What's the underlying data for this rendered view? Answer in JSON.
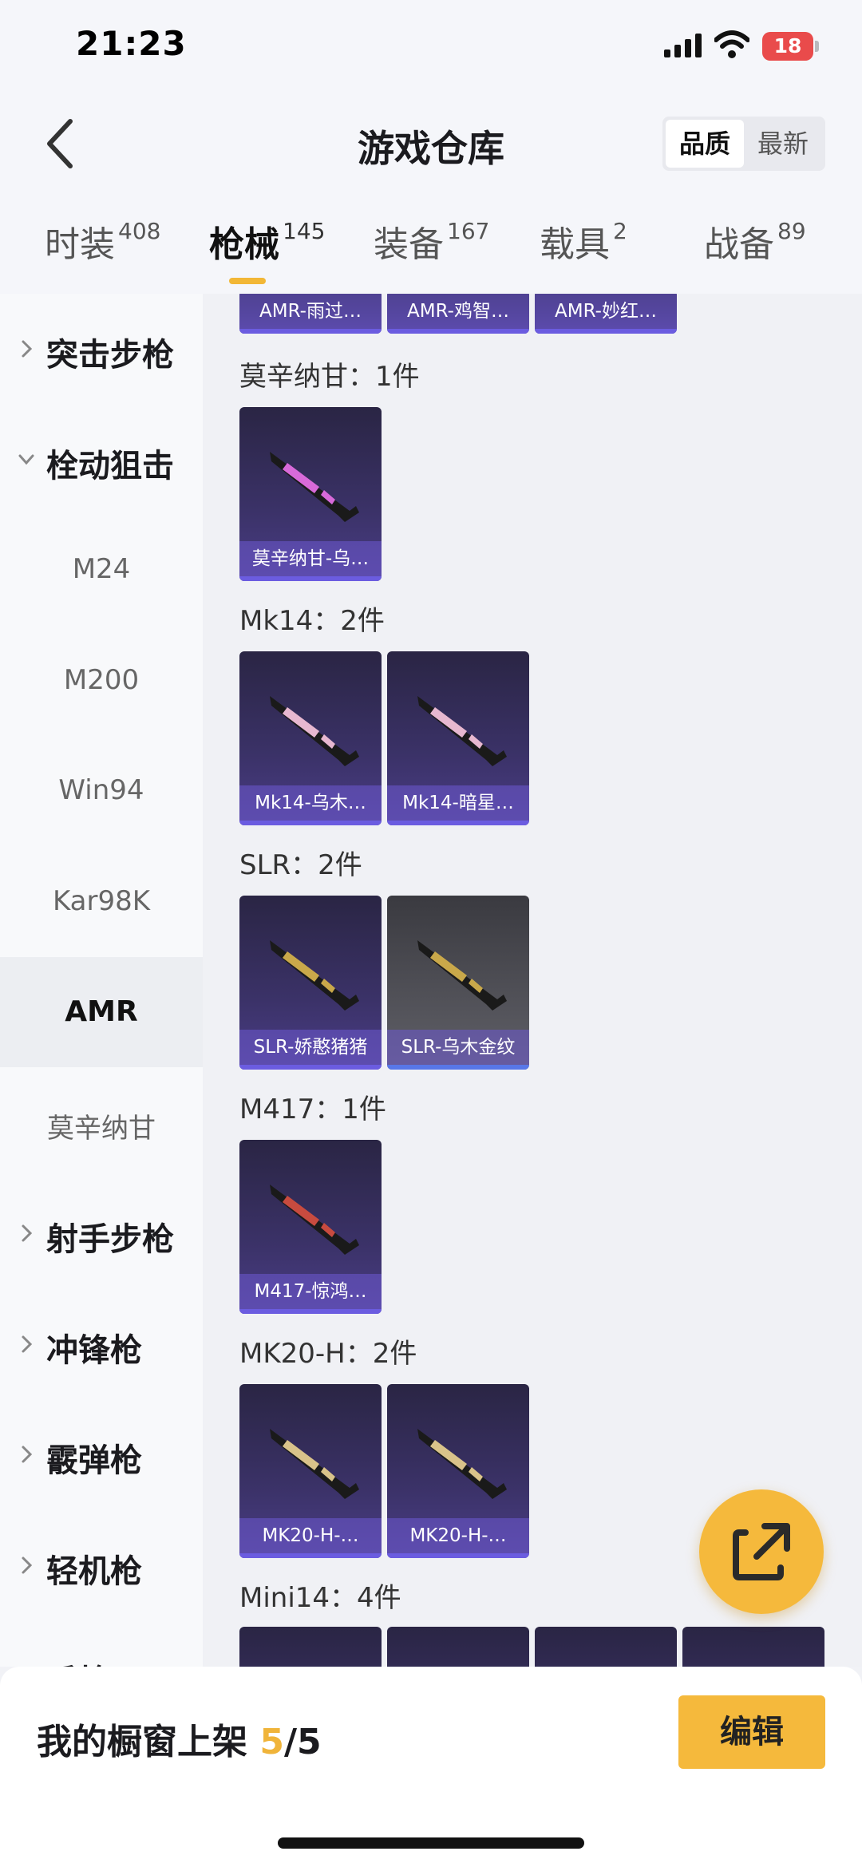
{
  "status_bar": {
    "time": "21:23",
    "battery": "18"
  },
  "header": {
    "title": "游戏仓库",
    "sort_options": [
      "品质",
      "最新"
    ]
  },
  "tabs": [
    {
      "label": "时装",
      "count": "408"
    },
    {
      "label": "枪械",
      "count": "145"
    },
    {
      "label": "装备",
      "count": "167"
    },
    {
      "label": "载具",
      "count": "2"
    },
    {
      "label": "战备",
      "count": "89"
    }
  ],
  "sidebar": [
    {
      "label": "突击步枪",
      "kind": "category"
    },
    {
      "label": "栓动狙击",
      "kind": "category-open"
    },
    {
      "label": "M24",
      "kind": "sub"
    },
    {
      "label": "M200",
      "kind": "sub"
    },
    {
      "label": "Win94",
      "kind": "sub"
    },
    {
      "label": "Kar98K",
      "kind": "sub"
    },
    {
      "label": "AMR",
      "kind": "sub-selected"
    },
    {
      "label": "莫辛纳甘",
      "kind": "sub"
    },
    {
      "label": "射手步枪",
      "kind": "category"
    },
    {
      "label": "冲锋枪",
      "kind": "category"
    },
    {
      "label": "霰弹枪",
      "kind": "category"
    },
    {
      "label": "轻机枪",
      "kind": "category"
    },
    {
      "label": "手枪",
      "kind": "category"
    }
  ],
  "groups": [
    {
      "title": "",
      "items": [
        "AMR-雨过…",
        "AMR-鸡智…",
        "AMR-妙红…"
      ]
    },
    {
      "title": "莫辛纳甘：1件",
      "items": [
        "莫辛纳甘-乌…"
      ]
    },
    {
      "title": "Mk14：2件",
      "items": [
        "Mk14-乌木…",
        "Mk14-暗星…"
      ]
    },
    {
      "title": "SLR：2件",
      "items": [
        "SLR-娇憨猪猪",
        "SLR-乌木金纹"
      ]
    },
    {
      "title": "M417：1件",
      "items": [
        "M417-惊鸿…"
      ]
    },
    {
      "title": "MK20-H：2件",
      "items": [
        "MK20-H-…",
        "MK20-H-…"
      ]
    },
    {
      "title": "Mini14：4件",
      "items": [
        "",
        "",
        "",
        ""
      ]
    }
  ],
  "bottom": {
    "showcase_label": "我的橱窗上架 ",
    "showcase_current": "5",
    "showcase_total": "/5",
    "edit_label": "编辑"
  },
  "colors": {
    "accent": "#f5b93c",
    "card_purple": "#3b3268",
    "card_grey": "#55555c",
    "battery_red": "#e94b4b"
  }
}
